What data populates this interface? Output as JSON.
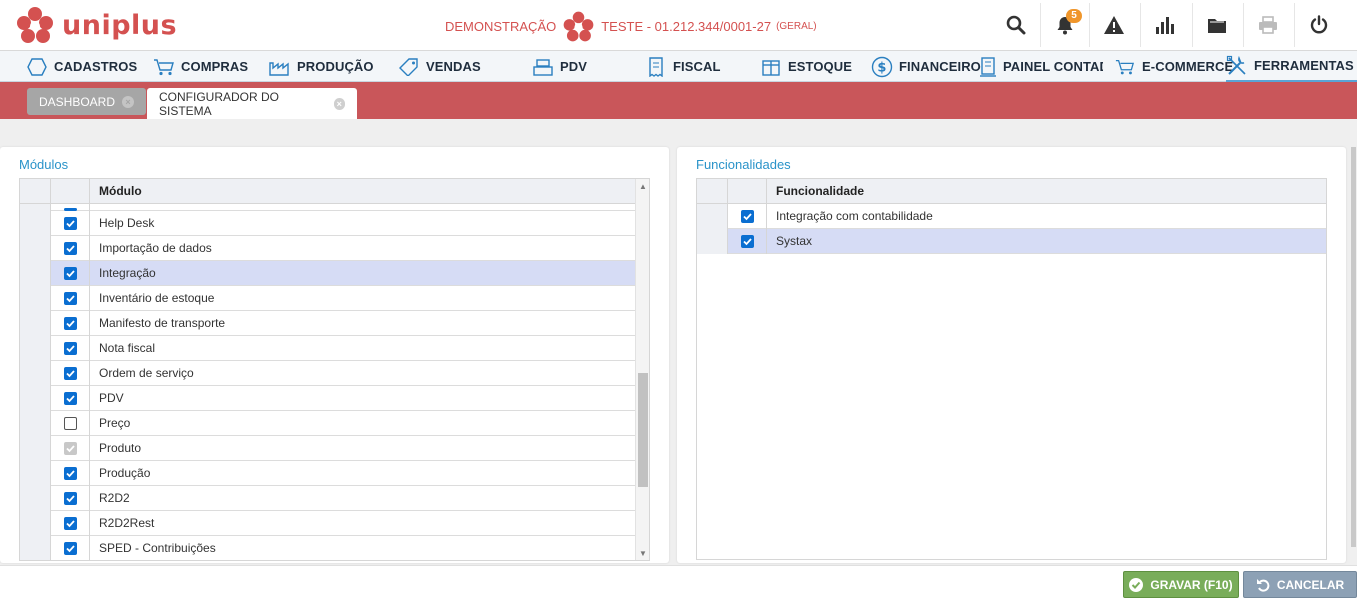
{
  "brand": {
    "name": "uniplus",
    "color": "#d45150"
  },
  "company": {
    "mode": "DEMONSTRAÇÃO",
    "name": "TESTE - 01.212.344/0001-27",
    "scope": "(GERAL)"
  },
  "toolbar": {
    "notifications_count": "5",
    "icons": [
      "search-icon",
      "bell-icon",
      "warning-icon",
      "bar-chart-icon",
      "folder-icon",
      "printer-icon",
      "power-icon"
    ]
  },
  "menu": {
    "items": [
      {
        "label": "CADASTROS",
        "icon": "hexagon-icon"
      },
      {
        "label": "COMPRAS",
        "icon": "cart-icon"
      },
      {
        "label": "PRODUÇÃO",
        "icon": "factory-icon"
      },
      {
        "label": "VENDAS",
        "icon": "tag-icon"
      },
      {
        "label": "PDV",
        "icon": "register-icon"
      },
      {
        "label": "FISCAL",
        "icon": "receipt-icon"
      },
      {
        "label": "ESTOQUE",
        "icon": "box-icon"
      },
      {
        "label": "FINANCEIRO",
        "icon": "dollar-icon"
      },
      {
        "label": "PAINEL CONTADOI",
        "icon": "document-icon"
      },
      {
        "label": "E-COMMERCE",
        "icon": "cart-icon"
      },
      {
        "label": "FERRAMENTAS",
        "icon": "tools-icon"
      }
    ],
    "active": "FERRAMENTAS"
  },
  "tabs": [
    {
      "label": "DASHBOARD",
      "active": false
    },
    {
      "label": "CONFIGURADOR DO SISTEMA",
      "active": true
    }
  ],
  "modules_panel": {
    "title": "Módulos",
    "column": "Módulo",
    "rows": [
      {
        "label": "Help Desk",
        "state": "checked"
      },
      {
        "label": "Importação de dados",
        "state": "checked"
      },
      {
        "label": "Integração",
        "state": "checked",
        "selected": true
      },
      {
        "label": "Inventário de estoque",
        "state": "checked"
      },
      {
        "label": "Manifesto de transporte",
        "state": "checked"
      },
      {
        "label": "Nota fiscal",
        "state": "checked"
      },
      {
        "label": "Ordem de serviço",
        "state": "checked"
      },
      {
        "label": "PDV",
        "state": "checked"
      },
      {
        "label": "Preço",
        "state": "unchecked"
      },
      {
        "label": "Produto",
        "state": "disabled"
      },
      {
        "label": "Produção",
        "state": "checked"
      },
      {
        "label": "R2D2",
        "state": "checked"
      },
      {
        "label": "R2D2Rest",
        "state": "checked"
      },
      {
        "label": "SPED - Contribuições",
        "state": "checked"
      }
    ]
  },
  "features_panel": {
    "title": "Funcionalidades",
    "column": "Funcionalidade",
    "rows": [
      {
        "label": "Integração com contabilidade",
        "state": "checked"
      },
      {
        "label": "Systax",
        "state": "checked",
        "selected": true
      }
    ]
  },
  "actions": {
    "save": "GRAVAR (F10)",
    "cancel": "CANCELAR"
  },
  "colors": {
    "accent_blue": "#2a93c9",
    "tabbar_red": "#c9565a",
    "checkbox_blue": "#0a6ed1",
    "save_green": "#79ad5a",
    "cancel_gray": "#8da1b5",
    "selected_row": "#d6dcf5"
  }
}
